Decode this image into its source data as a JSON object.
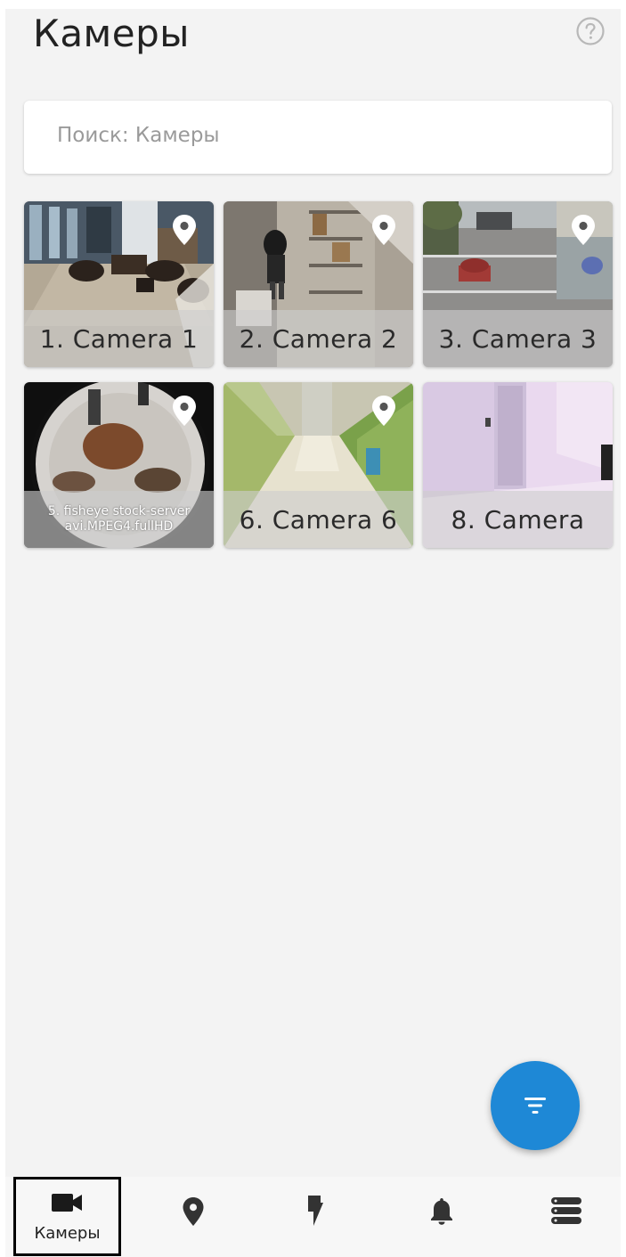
{
  "header": {
    "title": "Камеры",
    "help_icon": "question-circle-icon"
  },
  "search": {
    "placeholder": "Поиск: Камеры"
  },
  "cameras": [
    {
      "label": "1. Camera 1",
      "has_location": true
    },
    {
      "label": "2. Camera 2",
      "has_location": true
    },
    {
      "label": "3. Camera 3",
      "has_location": true
    },
    {
      "label_line1": "5. fisheye stock-server",
      "label_line2": "avi.MPEG4.fullHD",
      "has_location": true
    },
    {
      "label": "6. Camera 6",
      "has_location": true
    },
    {
      "label": "8. Camera",
      "has_location": false
    }
  ],
  "fab": {
    "icon": "filter-icon",
    "color": "#1e88d6"
  },
  "bottom_nav": {
    "items": [
      {
        "icon": "video-camera-icon",
        "label": "Камеры",
        "active": true
      },
      {
        "icon": "location-pin-icon",
        "label": ""
      },
      {
        "icon": "lightning-icon",
        "label": ""
      },
      {
        "icon": "bell-icon",
        "label": ""
      },
      {
        "icon": "server-menu-icon",
        "label": ""
      }
    ]
  }
}
